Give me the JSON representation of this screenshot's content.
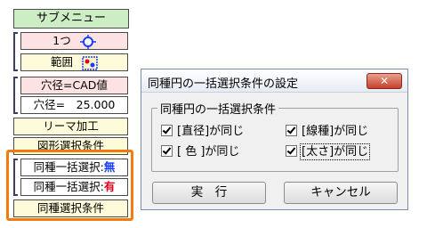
{
  "panel": {
    "submenu_label": "サブメニュー",
    "one_label": "1つ",
    "range_label": "範囲",
    "hole_cad_label": "穴径=CAD値",
    "hole_value_label": "穴径=　25.000",
    "ream_label": "リーマ加工",
    "shape_select_label": "図形選択条件",
    "bulk_none_prefix": "同種一括選択:",
    "bulk_none_value": "無",
    "bulk_yes_prefix": "同種一括選択:",
    "bulk_yes_value": "有",
    "same_kind_condition_label": "同種選択条件",
    "colors": {
      "highlight": "#f27b0c",
      "red": "#e8001a",
      "blue": "#1a3cff"
    }
  },
  "dialog": {
    "title": "同種円の一括選択条件の設定",
    "close_icon": "close-icon",
    "group_label": "同種円の一括選択条件",
    "options": {
      "diameter": "[直径]が同じ",
      "linetype": "[線種]が同じ",
      "color": "[ 色 ]が同じ",
      "thickness": "[太さ]が同じ"
    },
    "checked": {
      "diameter": true,
      "linetype": true,
      "color": true,
      "thickness": true
    },
    "execute_label": "実　行",
    "cancel_label": "キャンセル"
  }
}
